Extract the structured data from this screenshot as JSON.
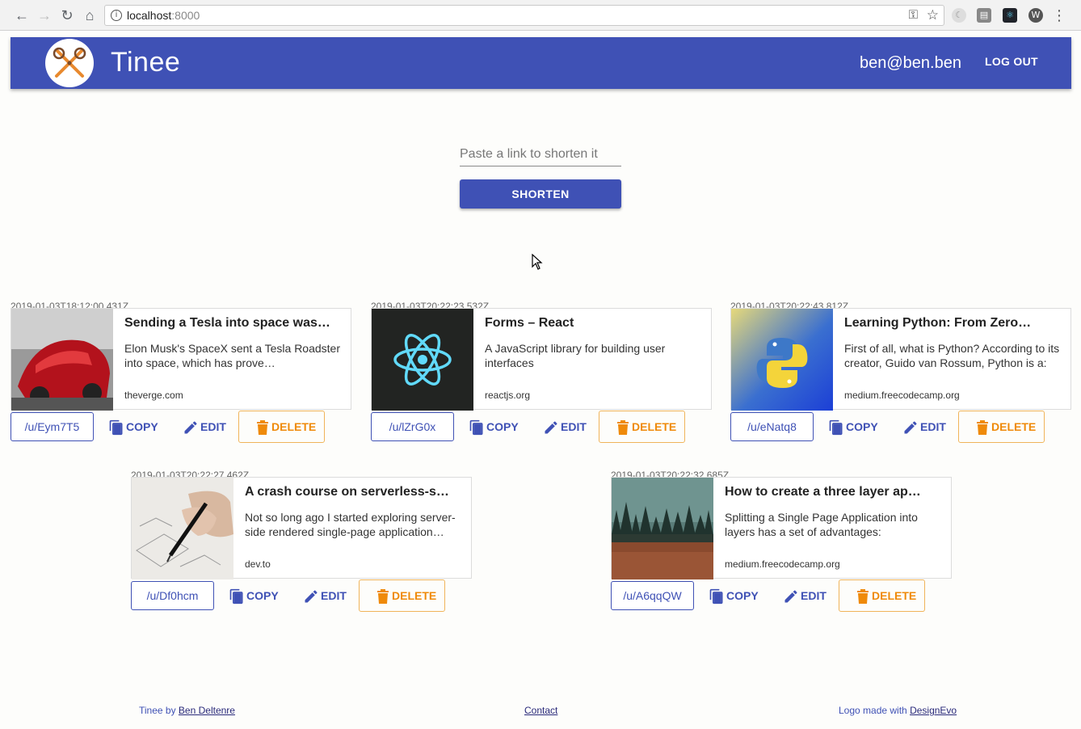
{
  "browser": {
    "url_host": "localhost",
    "url_port": ":8000"
  },
  "appbar": {
    "title": "Tinee",
    "user_email": "ben@ben.ben",
    "logout_label": "LOG OUT"
  },
  "form": {
    "placeholder": "Paste a link to shorten it",
    "value": "",
    "submit_label": "SHORTEN"
  },
  "actions": {
    "copy_label": "COPY",
    "edit_label": "EDIT",
    "delete_label": "DELETE"
  },
  "links": [
    {
      "date": "2019-01-03T18:12:00.431Z",
      "title": "Sending a Tesla into space was…",
      "description": "Elon Musk's SpaceX sent a Tesla Roadster into space, which has prove…",
      "domain": "theverge.com",
      "short": "/u/Eym7T5",
      "thumb": "tesla"
    },
    {
      "date": "2019-01-03T20:22:23.532Z",
      "title": "Forms – React",
      "description": "A JavaScript library for building user interfaces",
      "domain": "reactjs.org",
      "short": "/u/lZrG0x",
      "thumb": "react"
    },
    {
      "date": "2019-01-03T20:22:43.812Z",
      "title": "Learning Python: From Zero…",
      "description": "First of all, what is Python? According to its creator, Guido van Rossum, Python is a:",
      "domain": "medium.freecodecamp.org",
      "short": "/u/eNatq8",
      "thumb": "python"
    },
    {
      "date": "2019-01-03T20:22:27.462Z",
      "title": "A crash course on serverless-s…",
      "description": "Not so long ago I started exploring server-side rendered single-page application…",
      "domain": "dev.to",
      "short": "/u/Df0hcm",
      "thumb": "pen"
    },
    {
      "date": "2019-01-03T20:22:32.685Z",
      "title": "How to create a three layer ap…",
      "description": "Splitting a Single Page Application into layers has a set of advantages:",
      "domain": "medium.freecodecamp.org",
      "short": "/u/A6qqQW",
      "thumb": "forest"
    }
  ],
  "footer": {
    "credit_prefix": "Tinee by ",
    "credit_name": "Ben Deltenre",
    "contact": "Contact",
    "logo_prefix": "Logo made with ",
    "logo_link": "DesignEvo"
  },
  "colors": {
    "primary": "#3f51b5",
    "delete": "#ef8a0a"
  }
}
